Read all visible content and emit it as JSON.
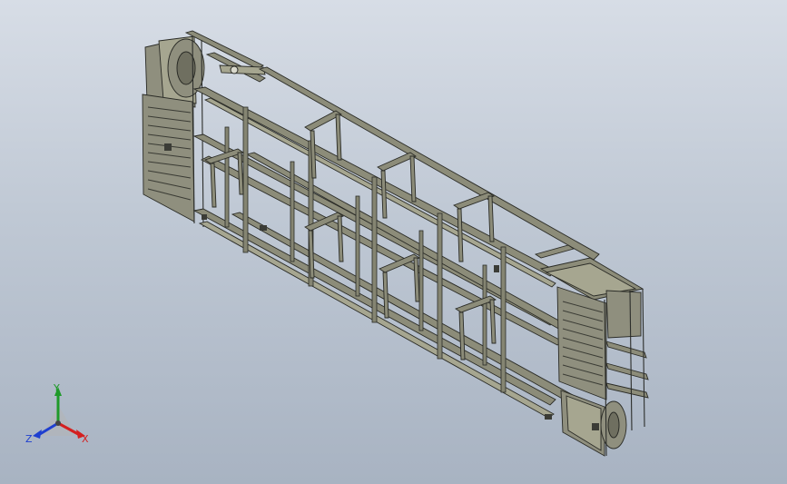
{
  "viewport": {
    "background_top": "#d7dde6",
    "background_bottom": "#a8b3c2",
    "model_color": "#8c8c79"
  },
  "triad": {
    "x_label": "X",
    "y_label": "Y",
    "z_label": "Z",
    "x_color": "#d42020",
    "y_color": "#1f9a2a",
    "z_color": "#1e3fd0"
  }
}
